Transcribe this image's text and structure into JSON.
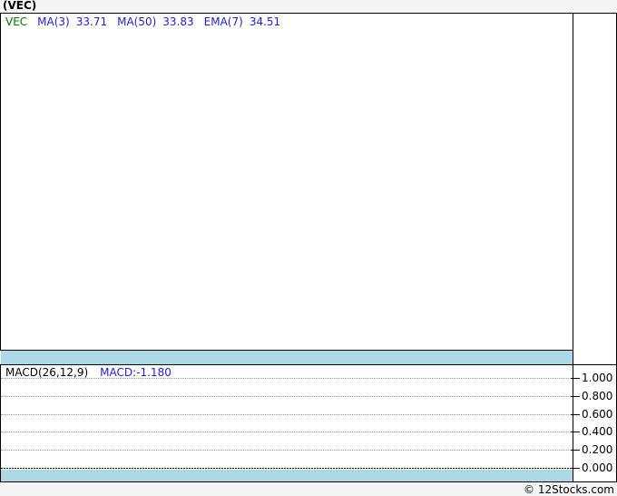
{
  "page": {
    "watermark": "© 12Stocks.com"
  },
  "header": {
    "title": "(VEC)"
  },
  "main_chart": {
    "legend": {
      "symbol": "VEC",
      "items": [
        {
          "label": "MA(3)",
          "value": "33.71"
        },
        {
          "label": "MA(50)",
          "value": "33.83"
        },
        {
          "label": "EMA(7)",
          "value": "34.51"
        }
      ]
    }
  },
  "macd_panel": {
    "label": "MACD(26,12,9)",
    "value": "MACD:-1.180",
    "axis_ticks": [
      "1.000",
      "0.800",
      "0.600",
      "0.400",
      "0.200",
      "0.000"
    ]
  },
  "colors": {
    "indicator_blue": "#2222CC",
    "symbol_green": "#007700",
    "divider_band_blue": "#ADD8E6",
    "gridline_gray": "#999999",
    "border_black": "#000000",
    "panel_background": "#FFFFFF",
    "page_background": "#F5F5F5"
  },
  "chart_data": [
    {
      "type": "line",
      "panel": "price",
      "title": "(VEC)",
      "series": [
        {
          "name": "VEC",
          "color": "#007700",
          "values": []
        },
        {
          "name": "MA(3)",
          "color": "#2222CC",
          "last_value": 33.71
        },
        {
          "name": "MA(50)",
          "color": "#2222CC",
          "last_value": 33.83
        },
        {
          "name": "EMA(7)",
          "color": "#2222CC",
          "last_value": 34.51
        }
      ],
      "note": "Price panel area is blank in the screenshot; only the legend values are shown."
    },
    {
      "type": "line",
      "panel": "macd",
      "title": "MACD(26,12,9)",
      "series": [
        {
          "name": "MACD",
          "last_value": -1.18,
          "values": []
        }
      ],
      "ylim": [
        0.0,
        1.0
      ],
      "yticks": [
        1.0,
        0.8,
        0.6,
        0.4,
        0.2,
        0.0
      ],
      "grid": true,
      "legend_position": "top-left",
      "note": "Only dotted horizontal gridlines visible; no MACD line or histogram plotted."
    }
  ]
}
